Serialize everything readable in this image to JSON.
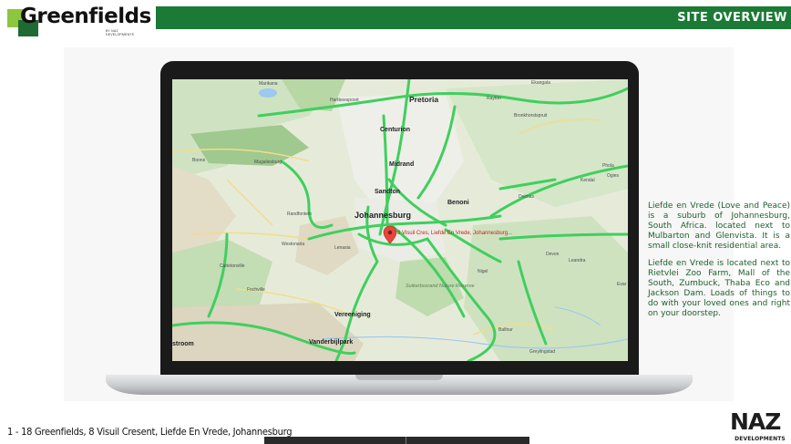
{
  "logo": {
    "name": "Greenfields",
    "sub": "BY NAZ DEVELOPMENTS"
  },
  "header": {
    "title": "SITE OVERVIEW"
  },
  "map": {
    "cities": [
      "Pretoria",
      "Centurion",
      "Midrand",
      "Sandton",
      "Benoni",
      "Johannesburg",
      "Vereeniging",
      "Vanderbijlpark"
    ],
    "towns": [
      "Marikana",
      "Hartbeespoort",
      "Rayton",
      "Ekangala",
      "Bronkhorstspruit",
      "Magaliesburg",
      "Boons",
      "Phola",
      "Ogies",
      "Kendal",
      "Delmas",
      "Randfontein",
      "Westonaria",
      "Lenasia",
      "Carletonville",
      "Fochville",
      "Nigel",
      "Devon",
      "Leandra",
      "Balfour",
      "Greylingstad",
      "stroom",
      "Evar"
    ],
    "reserve": "Suikerbosrand Nature Reserve",
    "pin_label": "8 Visuil Cres, Liefde En Vrede, Johannesburg..."
  },
  "description": {
    "p1": "Liefde en Vrede (Love and Peace) is a suburb of Johannesburg, South Africa. located next to Mulbarton and Glenvista. It is a small close-knit residential area.",
    "p2": "Liefde en Vrede is located next to Rietvlei Zoo Farm, Mall of the South, Zumbuck, Thaba Eco and Jackson Dam. Loads of things to do with your loved ones and right on your doorstep."
  },
  "footer": {
    "address": "1 - 18 Greenfields, 8 Visuil Cresent, Liefde En Vrede, Johannesburg",
    "brand": "NAZ",
    "brand_sub": "DEVELOPMENTS"
  },
  "colors": {
    "brand_green": "#1b7a35",
    "road_green": "#3fcf5e",
    "pin_red": "#e8453c"
  }
}
